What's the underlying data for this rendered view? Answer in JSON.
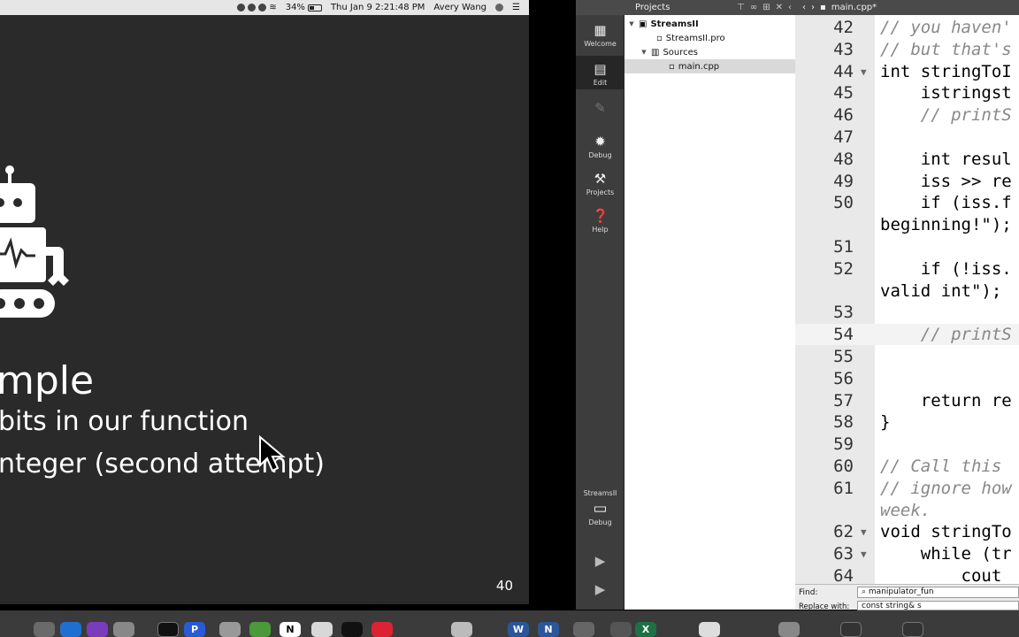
{
  "menubar": {
    "battery": "34%",
    "clock": "Thu Jan 9  2:21:48 PM",
    "user": "Avery Wang"
  },
  "slide": {
    "title": "mple",
    "line1": "bits in our function",
    "line2": "nteger (second attempt)",
    "page_number": "40"
  },
  "modes": [
    {
      "label": "Welcome"
    },
    {
      "label": "Edit"
    },
    {
      "label": "Design"
    },
    {
      "label": "Debug"
    },
    {
      "label": "Projects"
    },
    {
      "label": "Help"
    }
  ],
  "target": {
    "name": "StreamsII",
    "mode": "Debug"
  },
  "projects": {
    "header": "Projects",
    "root": "StreamsII",
    "pro_file": "StreamsII.pro",
    "sources": "Sources",
    "main_file": "main.cpp"
  },
  "editor": {
    "tab": "main.cpp*",
    "lines": [
      {
        "n": "42",
        "text": "// you haven'",
        "comment": true
      },
      {
        "n": "43",
        "text": "// but that's",
        "comment": true
      },
      {
        "n": "44",
        "text": "int stringToI",
        "comment": false
      },
      {
        "n": "45",
        "text": "    istringst",
        "comment": false
      },
      {
        "n": "46",
        "text": "    // printS",
        "comment": true
      },
      {
        "n": "47",
        "text": "",
        "comment": false
      },
      {
        "n": "48",
        "text": "    int resul",
        "comment": false
      },
      {
        "n": "49",
        "text": "    iss >> re",
        "comment": false
      },
      {
        "n": "50",
        "text": "    if (iss.f",
        "comment": false
      },
      {
        "n": "",
        "text": "beginning!\");",
        "comment": false
      },
      {
        "n": "51",
        "text": "",
        "comment": false
      },
      {
        "n": "52",
        "text": "    if (!iss.",
        "comment": false
      },
      {
        "n": "",
        "text": "valid int\");",
        "comment": false
      },
      {
        "n": "53",
        "text": "",
        "comment": false
      },
      {
        "n": "54",
        "text": "    // printS",
        "comment": true
      },
      {
        "n": "55",
        "text": "",
        "comment": false
      },
      {
        "n": "56",
        "text": "",
        "comment": false
      },
      {
        "n": "57",
        "text": "    return re",
        "comment": false
      },
      {
        "n": "58",
        "text": "}",
        "comment": false
      },
      {
        "n": "59",
        "text": "",
        "comment": false
      },
      {
        "n": "60",
        "text": "// Call this",
        "comment": true
      },
      {
        "n": "61",
        "text": "// ignore how",
        "comment": true
      },
      {
        "n": "",
        "text": "week.",
        "comment": true
      },
      {
        "n": "62",
        "text": "void stringTo",
        "comment": false
      },
      {
        "n": "63",
        "text": "    while (tr",
        "comment": false
      },
      {
        "n": "64",
        "text": "        cout ",
        "comment": false
      }
    ]
  },
  "find": {
    "find_label": "Find:",
    "find_value": "manipulator_fun",
    "replace_label": "Replace with:",
    "replace_value": "const string& s"
  },
  "dock": {
    "items": [
      "P",
      "N",
      "W",
      "N",
      "X"
    ]
  }
}
